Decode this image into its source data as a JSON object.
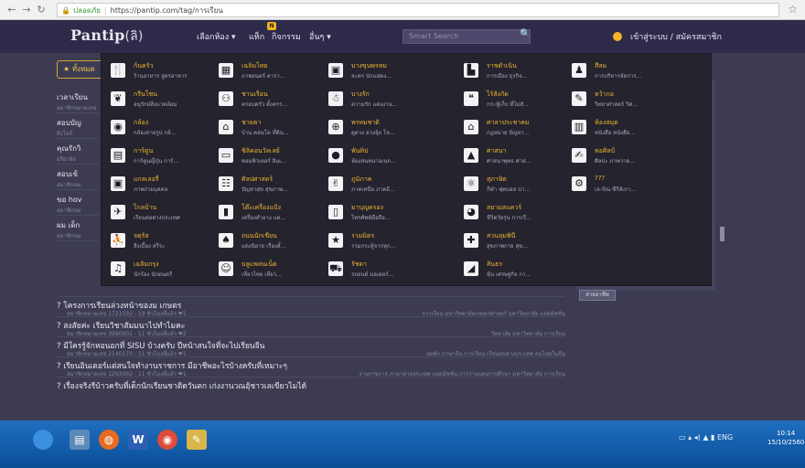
{
  "browser": {
    "url_secure": "ปลอดภัย",
    "url": "https://pantip.com/tag/การเรียน"
  },
  "header": {
    "logo": "Pantip",
    "logo_mark": "(ลิ)",
    "menu": [
      "เลือกห้อง ▾",
      "แท็ก",
      "กิจกรรม",
      "อื่นๆ ▾"
    ],
    "badge": "N",
    "search_placeholder": "Smart Search",
    "login": "เข้าสู่ระบบ / สมัครสมาชิก"
  },
  "page": {
    "tag_button": "★ ทั้งหมด",
    "stubs": [
      {
        "title": "เวลาเรียน",
        "sub": "สมาชิกหมายเลข"
      },
      {
        "title": "สอบบัญ",
        "sub": "สิ่งโลกี"
      },
      {
        "title": "คุณรักวิ",
        "sub": "อริยาลัย"
      },
      {
        "title": "สอบเข้",
        "sub": "สมาชิกหม"
      },
      {
        "title": "ขอ hov",
        "sub": "สมาชิกหม"
      },
      {
        "title": "ผม เด็ก",
        "sub": "สมาชิกหม"
      }
    ],
    "topics": [
      {
        "title": "? โครงการเรียนล่วงหน้าของม เกษตร",
        "meta": "สมาชิกหมายเลข 1721592 - 19 ชั่วโมงที่แล้ว ❤1",
        "tags": "การเรียน มหาวิทยาลัยเกษตรศาสตร์ มหาวิทยาลัย แอดมิชชั่น"
      },
      {
        "title": "? สงสัยค่ะ เรียนวิชาสัมมนาไปทำไมคะ",
        "meta": "สมาชิกหมายเลข 3990901 - 11 ชั่วโมงที่แล้ว ❤2",
        "tags": "วิทยาลัย มหาวิทยาลัย การเรียน"
      },
      {
        "title": "? มีใครรู้จักหอนอกที่ SISU บ้างครับ ปีหน้าสนใจที่จะไปเรียนจีน",
        "meta": "สมาชิกหมายเลข 2140170 - 11 ชั่วโมงที่แล้ว ❤1",
        "tags": "หอพัก ภาษาจีน การเรียน เรียนต่อต่างประเทศ คนไทยในจีน"
      },
      {
        "title": "? เรียนอินเตอร์แต่สนใจทำงานราชการ มีอาชีพอะไรบ้างครับที่เหมาะๆ",
        "meta": "สมาชิกหมายเลข 1293062 - 11 ชั่วโมงที่แล้ว ❤1",
        "tags": "งานราชการ ภาษาต่างประเทศ แอดมิชชั่น การวางแผนการศึกษา มหาวิทยาลัย การเรียน"
      },
      {
        "title": "? เรื่องจริงรีบ้าวครับที่เด็กนักเรียนชาติดวันตก เก่งงานวณอุ้ชาวเลเขียวไมได้",
        "meta": "",
        "tags": ""
      }
    ],
    "right_button": "สายอาชีพ"
  },
  "dropdown": {
    "columns": [
      [
        {
          "icon": "fork-knife-icon",
          "glyph": "🍴",
          "name": "ก้นครัว",
          "desc": "ร้านอาหาร สูตรอาหาร"
        },
        {
          "icon": "leaf-icon",
          "glyph": "❦",
          "name": "กรีนโซน",
          "desc": "อนุรักษ์สิ่งแวดล้อม"
        },
        {
          "icon": "camera-icon",
          "glyph": "◉",
          "name": "กล้อง",
          "desc": "กล้องถ่ายรูป กล้..."
        },
        {
          "icon": "book-icon",
          "glyph": "▤",
          "name": "การ์ตูน",
          "desc": "การ์ตูนญี่ปุ่น การ์..."
        },
        {
          "icon": "picture-icon",
          "glyph": "▣",
          "name": "แกลเลอรี่",
          "desc": "ภาพถ่ายบุคคล"
        },
        {
          "icon": "plane-icon",
          "glyph": "✈",
          "name": "ไกลบ้าน",
          "desc": "เรียนต่อต่างประเทศ"
        },
        {
          "icon": "sports-icon",
          "glyph": "⛹",
          "name": "จตุรัส",
          "desc": "สิ่งเบื้อง สรีระ"
        },
        {
          "icon": "music-icon",
          "glyph": "♫",
          "name": "เฉลิมกรุง",
          "desc": "นักร้อง นักดนตรี"
        }
      ],
      [
        {
          "icon": "tv-icon",
          "glyph": "▦",
          "name": "เฉลิมไทย",
          "desc": "ภาพยนตร์ ดารา..."
        },
        {
          "icon": "family-icon",
          "glyph": "⚇",
          "name": "ชานเรือน",
          "desc": "ครอบครัว ตั้งครร..."
        },
        {
          "icon": "house-icon",
          "glyph": "⌂",
          "name": "ชายคา",
          "desc": "บ้าน คอนโด ที่ดิน..."
        },
        {
          "icon": "computer-icon",
          "glyph": "▭",
          "name": "ซิลิคอนวัลเลย์",
          "desc": "คอมพิวเตอร์ อินเ..."
        },
        {
          "icon": "people-icon",
          "glyph": "☷",
          "name": "ศิลปศาสตร์",
          "desc": "ปัญหาสุข สุขภาพ..."
        },
        {
          "icon": "bottle-icon",
          "glyph": "▮",
          "name": "โต๊ะเครื่องแป้ง",
          "desc": "เครื่องสำอาง แต..."
        },
        {
          "icon": "drink-icon",
          "glyph": "♠",
          "name": "ถนนนักเขียน",
          "desc": "แต่งนิยาย เรื่องสั้..."
        },
        {
          "icon": "baby-icon",
          "glyph": "☺",
          "name": "บลูแพลนเน็ต",
          "desc": "เที่ยวไทย เที่ยว..."
        }
      ],
      [
        {
          "icon": "radio-icon",
          "glyph": "▣",
          "name": "บางขุนพรหม",
          "desc": "ละคร นักแสดง..."
        },
        {
          "icon": "robot-icon",
          "glyph": "☃",
          "name": "บางรัก",
          "desc": "ความรัก แต่งงาน..."
        },
        {
          "icon": "globe-icon",
          "glyph": "⊕",
          "name": "พรหมชาติ",
          "desc": "ดูดวง ฮวงจุ้ย โห..."
        },
        {
          "icon": "egg-icon",
          "glyph": "●",
          "name": "พันทิป",
          "desc": "ห้องสนทนาอเนก..."
        },
        {
          "icon": "runner-icon",
          "glyph": "✌",
          "name": "ภูมิภาค",
          "desc": "ภาคเหนือ ภาคอี..."
        },
        {
          "icon": "phone-icon",
          "glyph": "▯",
          "name": "มาบุญครอง",
          "desc": "โทรศัพท์มือถือ..."
        },
        {
          "icon": "star-icon",
          "glyph": "★",
          "name": "รวมมิตร",
          "desc": "รวมกระทู้จากทุก..."
        },
        {
          "icon": "car-icon",
          "glyph": "⛟",
          "name": "รัชดา",
          "desc": "รถยนต์ มอเตอร์..."
        }
      ],
      [
        {
          "icon": "building-icon",
          "glyph": "▙",
          "name": "ราชดำเนิน",
          "desc": "การเมือง ธุรกิจ..."
        },
        {
          "icon": "quote-icon",
          "glyph": "❝",
          "name": "ไร้สังกัด",
          "desc": "กระทู้เก็บ ที่ไม่สั..."
        },
        {
          "icon": "temple-icon",
          "glyph": "⌂",
          "name": "ศาลาประชาคม",
          "desc": "กฎหมาย ปัญหา..."
        },
        {
          "icon": "mountain-icon",
          "glyph": "▲",
          "name": "ศาสนา",
          "desc": "ศาสนาพุทธ ศาส..."
        },
        {
          "icon": "lab-icon",
          "glyph": "⚛",
          "name": "สุภาษิต",
          "desc": "กีฬา ฟุตบอล บา..."
        },
        {
          "icon": "disk-icon",
          "glyph": "◕",
          "name": "สยามสแควร์",
          "desc": "ชีวิตวัยรุ่น การเรี..."
        },
        {
          "icon": "plus-icon",
          "glyph": "✚",
          "name": "สวนลุมพินี",
          "desc": "สุขภาพกาย สุข..."
        },
        {
          "icon": "chart-icon",
          "glyph": "◢",
          "name": "สินธร",
          "desc": "หุ้น เศรษฐกิจ กา..."
        }
      ],
      [
        {
          "icon": "person-icon",
          "glyph": "♟",
          "name": "สีลม",
          "desc": "การบริหารจัดการ..."
        },
        {
          "icon": "pen-icon",
          "glyph": "✎",
          "name": "หว้ากอ",
          "desc": "วิทยาศาสตร์ วิศ..."
        },
        {
          "icon": "open-book-icon",
          "glyph": "▥",
          "name": "ห้องสมุด",
          "desc": "หนังสือ หนังสือ..."
        },
        {
          "icon": "brush-icon",
          "glyph": "✍",
          "name": "หอศิลป์",
          "desc": "ศิลปะ ภาพวาด..."
        },
        {
          "icon": "gear-icon",
          "glyph": "⚙",
          "name": "???",
          "desc": "เล-ปัณ ซีรีส์เกา..."
        }
      ]
    ]
  },
  "taskbar": {
    "tray": "▭ ▴ ◂) ▲ ▮ ENG",
    "time": "10:14",
    "date": "15/10/2560"
  }
}
